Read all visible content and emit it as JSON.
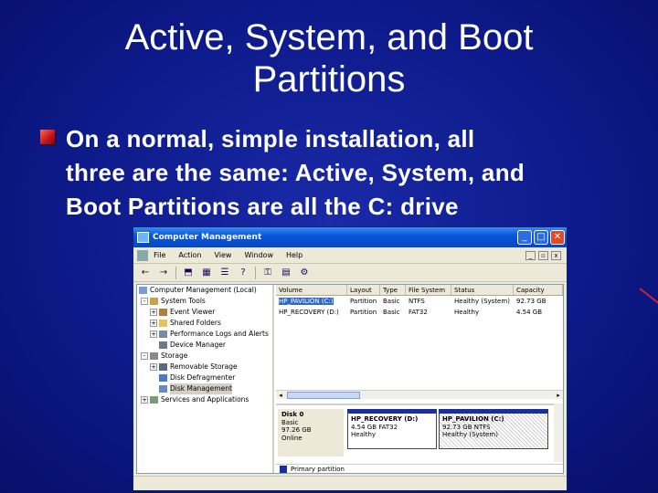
{
  "slide": {
    "title_lines": [
      "Active, System, and Boot",
      "Partitions"
    ],
    "bullet_lines": [
      "On a normal, simple installation, all",
      "three are the same: Active, System, and",
      "Boot Partitions are all the C: drive"
    ]
  },
  "window": {
    "title": "Computer Management",
    "menu": [
      "File",
      "Action",
      "View",
      "Window",
      "Help"
    ],
    "toolbar_icons": [
      "back-icon",
      "forward-icon",
      "up-icon",
      "show-hide-tree-icon",
      "properties-icon",
      "help-icon",
      "key-icon",
      "export-icon",
      "settings-icon"
    ],
    "tree": [
      {
        "label": "Computer Management (Local)",
        "level": 0,
        "exp": "-"
      },
      {
        "label": "System Tools",
        "level": 1,
        "exp": "-"
      },
      {
        "label": "Event Viewer",
        "level": 2,
        "exp": "+"
      },
      {
        "label": "Shared Folders",
        "level": 2,
        "exp": "+"
      },
      {
        "label": "Performance Logs and Alerts",
        "level": 2,
        "exp": "+"
      },
      {
        "label": "Device Manager",
        "level": 2,
        "exp": ""
      },
      {
        "label": "Storage",
        "level": 1,
        "exp": "-"
      },
      {
        "label": "Removable Storage",
        "level": 2,
        "exp": "+"
      },
      {
        "label": "Disk Defragmenter",
        "level": 2,
        "exp": ""
      },
      {
        "label": "Disk Management",
        "level": 2,
        "exp": ""
      },
      {
        "label": "Services and Applications",
        "level": 1,
        "exp": "+"
      }
    ],
    "columns": [
      "Volume",
      "Layout",
      "Type",
      "File System",
      "Status",
      "Capacity"
    ],
    "volumes": [
      [
        "HP_PAVILION (C:)",
        "Partition",
        "Basic",
        "NTFS",
        "Healthy (System)",
        "92.73 GB"
      ],
      [
        "HP_RECOVERY (D:)",
        "Partition",
        "Basic",
        "FAT32",
        "Healthy",
        "4.54 GB"
      ]
    ],
    "disk": {
      "name": "Disk 0",
      "type": "Basic",
      "size": "97.26 GB",
      "status": "Online",
      "partitions": [
        {
          "name": "HP_RECOVERY (D:)",
          "size": "4.54 GB FAT32",
          "status": "Healthy"
        },
        {
          "name": "HP_PAVILION (C:)",
          "size": "92.73 GB NTFS",
          "status": "Healthy (System)"
        }
      ]
    },
    "legend": "Primary partition"
  }
}
